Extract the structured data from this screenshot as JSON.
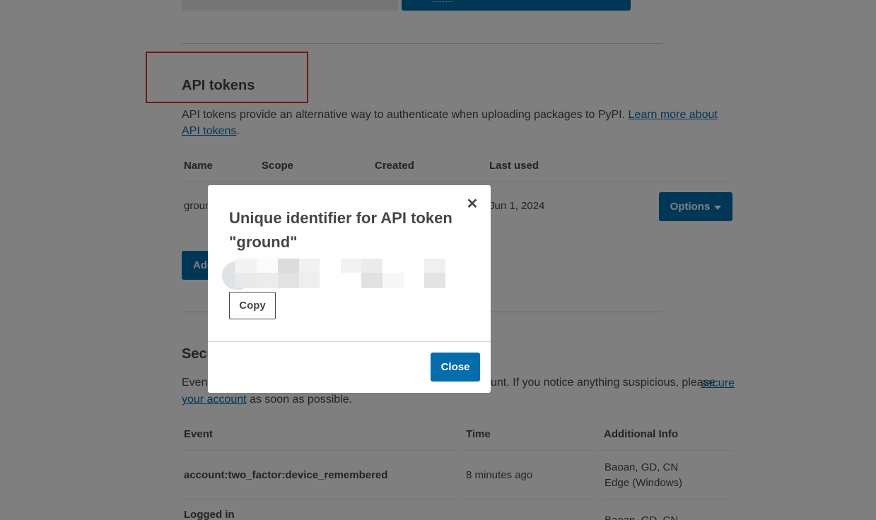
{
  "api_tokens": {
    "title": "API tokens",
    "description": "API tokens provide an alternative way to authenticate when uploading packages to PyPI.",
    "learn_more_link": "Learn more about API tokens",
    "headers": {
      "name": "Name",
      "scope": "Scope",
      "created": "Created",
      "last_used": "Last used"
    },
    "row": {
      "name": "groun",
      "last_used": "Jun 1, 2024",
      "options_label": "Options"
    },
    "add_label": "Add"
  },
  "security_history": {
    "title": "Secu",
    "desc_start": "Event",
    "desc_mid": "unt. If you notice anything suspicious, please",
    "secure_link": "secure your account",
    "desc_end": "as soon as possible.",
    "headers": {
      "event": "Event",
      "time": "Time",
      "additional_info": "Additional Info"
    },
    "rows": [
      {
        "event": "account:two_factor:device_remembered",
        "time": "8 minutes ago",
        "info_line1": "Baoan, GD, CN",
        "info_line2": "Edge (Windows)"
      },
      {
        "event": "Logged in",
        "time": "",
        "info_line1": "Baoan, GD, CN",
        "info_line2": ""
      }
    ]
  },
  "modal": {
    "title": "Unique identifier for API token \"ground\"",
    "copy_label": "Copy",
    "close_label": "Close",
    "close_icon": "close-icon"
  },
  "colors": {
    "accent": "#006dad",
    "highlight": "#e03030"
  }
}
